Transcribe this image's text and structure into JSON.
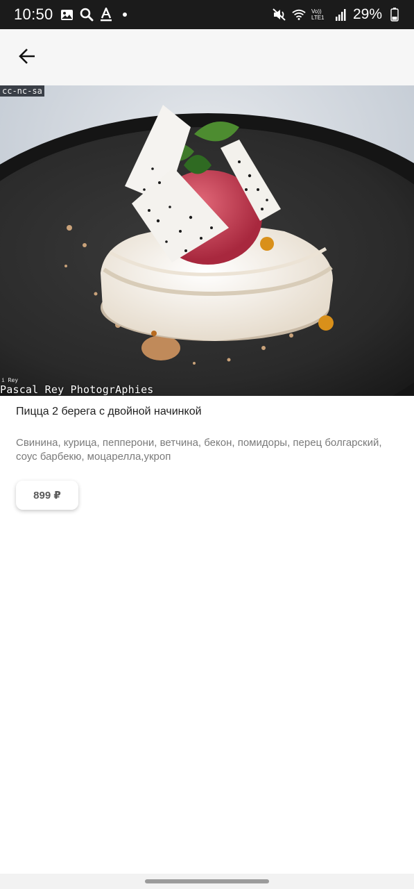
{
  "status_bar": {
    "time": "10:50",
    "battery_percent": "29%",
    "left_icons": [
      "gallery-icon",
      "search-icon",
      "text-format-icon",
      "notification-dot-icon"
    ],
    "right_icons": [
      "mute-icon",
      "wifi-icon",
      "volte-lte-icon",
      "signal-icon",
      "battery-icon"
    ],
    "network_label": "Vo)) LTE1"
  },
  "app_bar": {
    "back_icon": "arrow-left-icon"
  },
  "hero_image": {
    "license_tag": "cc-nc-sa",
    "credit_small": "i Rey",
    "credit": "Pascal Rey PhotogrAphies"
  },
  "product": {
    "title": "Пицца 2 берега с двойной начинкой",
    "description": "Свинина, курица, пепперони, ветчина, бекон, помидоры, перец болгарский, соус барбекю, моцарелла,укроп",
    "price": "899 ₽"
  },
  "colors": {
    "status_bar_bg": "#1b1b1b",
    "app_bar_bg": "#f6f6f6",
    "title_text": "#1e1e1e",
    "description_text": "#7a7a7a",
    "price_text": "#5a5a5a"
  }
}
